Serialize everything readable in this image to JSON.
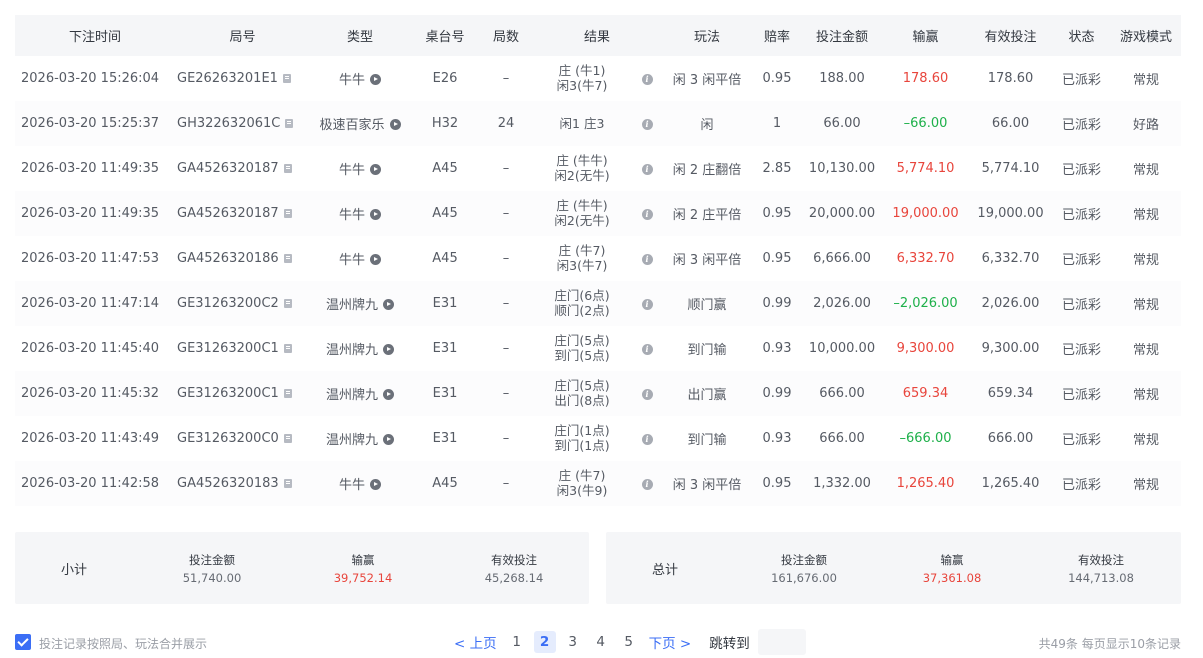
{
  "columns": [
    "下注时间",
    "局号",
    "类型",
    "桌台号",
    "局数",
    "结果",
    "玩法",
    "赔率",
    "投注金额",
    "输赢",
    "有效投注",
    "状态",
    "游戏模式"
  ],
  "rows": [
    {
      "time": "2026-03-20 15:26:04",
      "round": "GE26263201E1",
      "type": "牛牛",
      "table": "E26",
      "count": "–",
      "result1": "庄 (牛1)",
      "result2": "闲3(牛7)",
      "play": "闲 3 闲平倍",
      "odds": "0.95",
      "bet": "188.00",
      "winloss": "178.60",
      "win_sign": "pos",
      "valid": "178.60",
      "status": "已派彩",
      "mode": "常规"
    },
    {
      "time": "2026-03-20 15:25:37",
      "round": "GH322632061C",
      "type": "极速百家乐",
      "table": "H32",
      "count": "24",
      "result1": "闲1 庄3",
      "result2": "",
      "play": "闲",
      "odds": "1",
      "bet": "66.00",
      "winloss": "–66.00",
      "win_sign": "neg",
      "valid": "66.00",
      "status": "已派彩",
      "mode": "好路"
    },
    {
      "time": "2026-03-20 11:49:35",
      "round": "GA4526320187",
      "type": "牛牛",
      "table": "A45",
      "count": "–",
      "result1": "庄 (牛牛)",
      "result2": "闲2(无牛)",
      "play": "闲 2 庄翻倍",
      "odds": "2.85",
      "bet": "10,130.00",
      "winloss": "5,774.10",
      "win_sign": "pos",
      "valid": "5,774.10",
      "status": "已派彩",
      "mode": "常规"
    },
    {
      "time": "2026-03-20 11:49:35",
      "round": "GA4526320187",
      "type": "牛牛",
      "table": "A45",
      "count": "–",
      "result1": "庄 (牛牛)",
      "result2": "闲2(无牛)",
      "play": "闲 2 庄平倍",
      "odds": "0.95",
      "bet": "20,000.00",
      "winloss": "19,000.00",
      "win_sign": "pos",
      "valid": "19,000.00",
      "status": "已派彩",
      "mode": "常规"
    },
    {
      "time": "2026-03-20 11:47:53",
      "round": "GA4526320186",
      "type": "牛牛",
      "table": "A45",
      "count": "–",
      "result1": "庄 (牛7)",
      "result2": "闲3(牛7)",
      "play": "闲 3 闲平倍",
      "odds": "0.95",
      "bet": "6,666.00",
      "winloss": "6,332.70",
      "win_sign": "pos",
      "valid": "6,332.70",
      "status": "已派彩",
      "mode": "常规"
    },
    {
      "time": "2026-03-20 11:47:14",
      "round": "GE31263200C2",
      "type": "温州牌九",
      "table": "E31",
      "count": "–",
      "result1": "庄门(6点)",
      "result2": "顺门(2点)",
      "play": "顺门赢",
      "odds": "0.99",
      "bet": "2,026.00",
      "winloss": "–2,026.00",
      "win_sign": "neg",
      "valid": "2,026.00",
      "status": "已派彩",
      "mode": "常规"
    },
    {
      "time": "2026-03-20 11:45:40",
      "round": "GE31263200C1",
      "type": "温州牌九",
      "table": "E31",
      "count": "–",
      "result1": "庄门(5点)",
      "result2": "到门(5点)",
      "play": "到门输",
      "odds": "0.93",
      "bet": "10,000.00",
      "winloss": "9,300.00",
      "win_sign": "pos",
      "valid": "9,300.00",
      "status": "已派彩",
      "mode": "常规"
    },
    {
      "time": "2026-03-20 11:45:32",
      "round": "GE31263200C1",
      "type": "温州牌九",
      "table": "E31",
      "count": "–",
      "result1": "庄门(5点)",
      "result2": "出门(8点)",
      "play": "出门赢",
      "odds": "0.99",
      "bet": "666.00",
      "winloss": "659.34",
      "win_sign": "pos",
      "valid": "659.34",
      "status": "已派彩",
      "mode": "常规"
    },
    {
      "time": "2026-03-20 11:43:49",
      "round": "GE31263200C0",
      "type": "温州牌九",
      "table": "E31",
      "count": "–",
      "result1": "庄门(1点)",
      "result2": "到门(1点)",
      "play": "到门输",
      "odds": "0.93",
      "bet": "666.00",
      "winloss": "–666.00",
      "win_sign": "neg",
      "valid": "666.00",
      "status": "已派彩",
      "mode": "常规"
    },
    {
      "time": "2026-03-20 11:42:58",
      "round": "GA4526320183",
      "type": "牛牛",
      "table": "A45",
      "count": "–",
      "result1": "庄 (牛7)",
      "result2": "闲3(牛9)",
      "play": "闲 3 闲平倍",
      "odds": "0.95",
      "bet": "1,332.00",
      "winloss": "1,265.40",
      "win_sign": "pos",
      "valid": "1,265.40",
      "status": "已派彩",
      "mode": "常规"
    }
  ],
  "subtotal": {
    "label": "小计",
    "bet_label": "投注金额",
    "bet": "51,740.00",
    "win_label": "输赢",
    "win": "39,752.14",
    "valid_label": "有效投注",
    "valid": "45,268.14"
  },
  "total": {
    "label": "总计",
    "bet_label": "投注金额",
    "bet": "161,676.00",
    "win_label": "输赢",
    "win": "37,361.08",
    "valid_label": "有效投注",
    "valid": "144,713.08"
  },
  "footer": {
    "merge_label": "投注记录按照局、玩法合并展示",
    "prev": "< 上页",
    "next": "下页 >",
    "pages": [
      "1",
      "2",
      "3",
      "4",
      "5"
    ],
    "current_page": "2",
    "jump_label": "跳转到",
    "info": "共49条  每页显示10条记录"
  },
  "colors": {
    "win": "#e8453c",
    "loss": "#1eb04a",
    "accent": "#3b6ef5"
  }
}
